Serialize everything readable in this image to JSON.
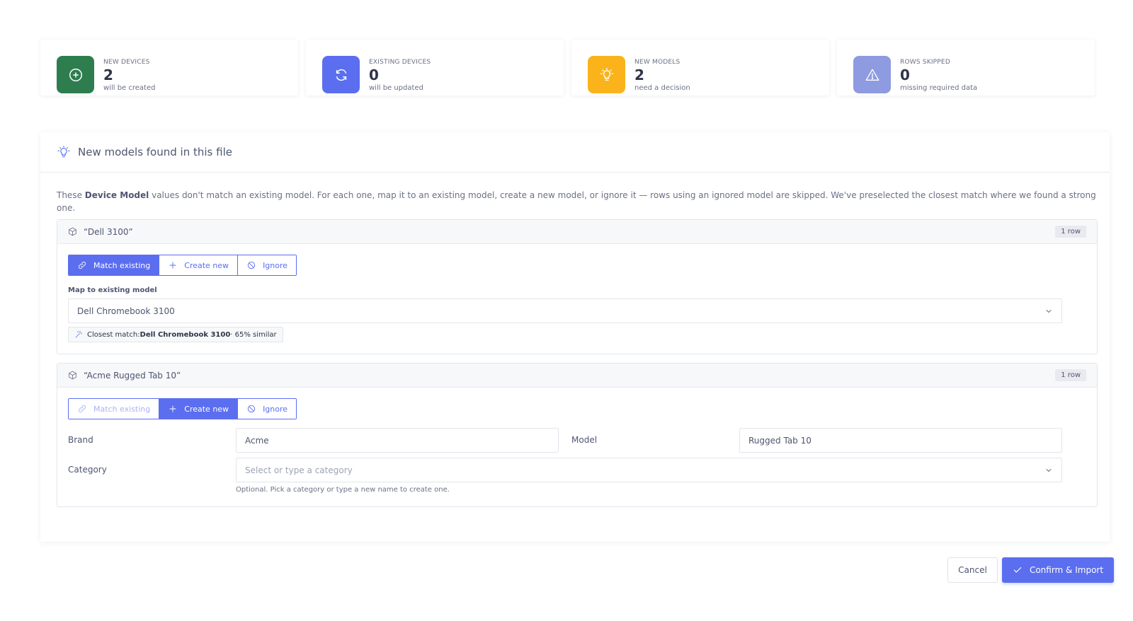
{
  "stats": [
    {
      "label": "NEW DEVICES",
      "value": "2",
      "sub": "will be created",
      "icon": "plus-circle-icon",
      "color": "#2e7d4f"
    },
    {
      "label": "EXISTING DEVICES",
      "value": "0",
      "sub": "will be updated",
      "icon": "refresh-icon",
      "color": "#5b6ef0"
    },
    {
      "label": "NEW MODELS",
      "value": "2",
      "sub": "need a decision",
      "icon": "lightbulb-icon",
      "color": "#fbb31c"
    },
    {
      "label": "ROWS SKIPPED",
      "value": "0",
      "sub": "missing required data",
      "icon": "warning-icon",
      "color": "#8e9be0"
    }
  ],
  "panel": {
    "title": "New models found in this file",
    "intro_before": "These ",
    "intro_bold": "Device Model",
    "intro_after": " values don't match an existing model. For each one, map it to an existing model, create a new model, or ignore it — rows using an ignored model are skipped. We've preselected the closest match where we found a strong one."
  },
  "models": [
    {
      "name": "“Dell 3100”",
      "rows": "1 row",
      "options": {
        "match": "Match existing",
        "create": "Create new",
        "ignore": "Ignore"
      },
      "selected": "match",
      "map_label": "Map to existing model",
      "map_value": "Dell Chromebook 3100",
      "hint_prefix": "Closest match: ",
      "hint_bold": "Dell Chromebook 3100",
      "hint_suffix": " · 65% similar"
    },
    {
      "name": "“Acme Rugged Tab 10”",
      "rows": "1 row",
      "options": {
        "match": "Match existing",
        "create": "Create new",
        "ignore": "Ignore"
      },
      "selected": "create",
      "brand_label": "Brand",
      "brand_value": "Acme",
      "model_label": "Model",
      "model_value": "Rugged Tab 10",
      "category_label": "Category",
      "category_placeholder": "Select or type a category",
      "category_help": "Optional. Pick a category or type a new name to create one."
    }
  ],
  "actions": {
    "cancel": "Cancel",
    "confirm": "Confirm & Import"
  },
  "colors": {
    "accent": "#5b6ef0",
    "green": "#2e7d4f",
    "amber": "#fbb31c",
    "lavender": "#8e9be0"
  }
}
